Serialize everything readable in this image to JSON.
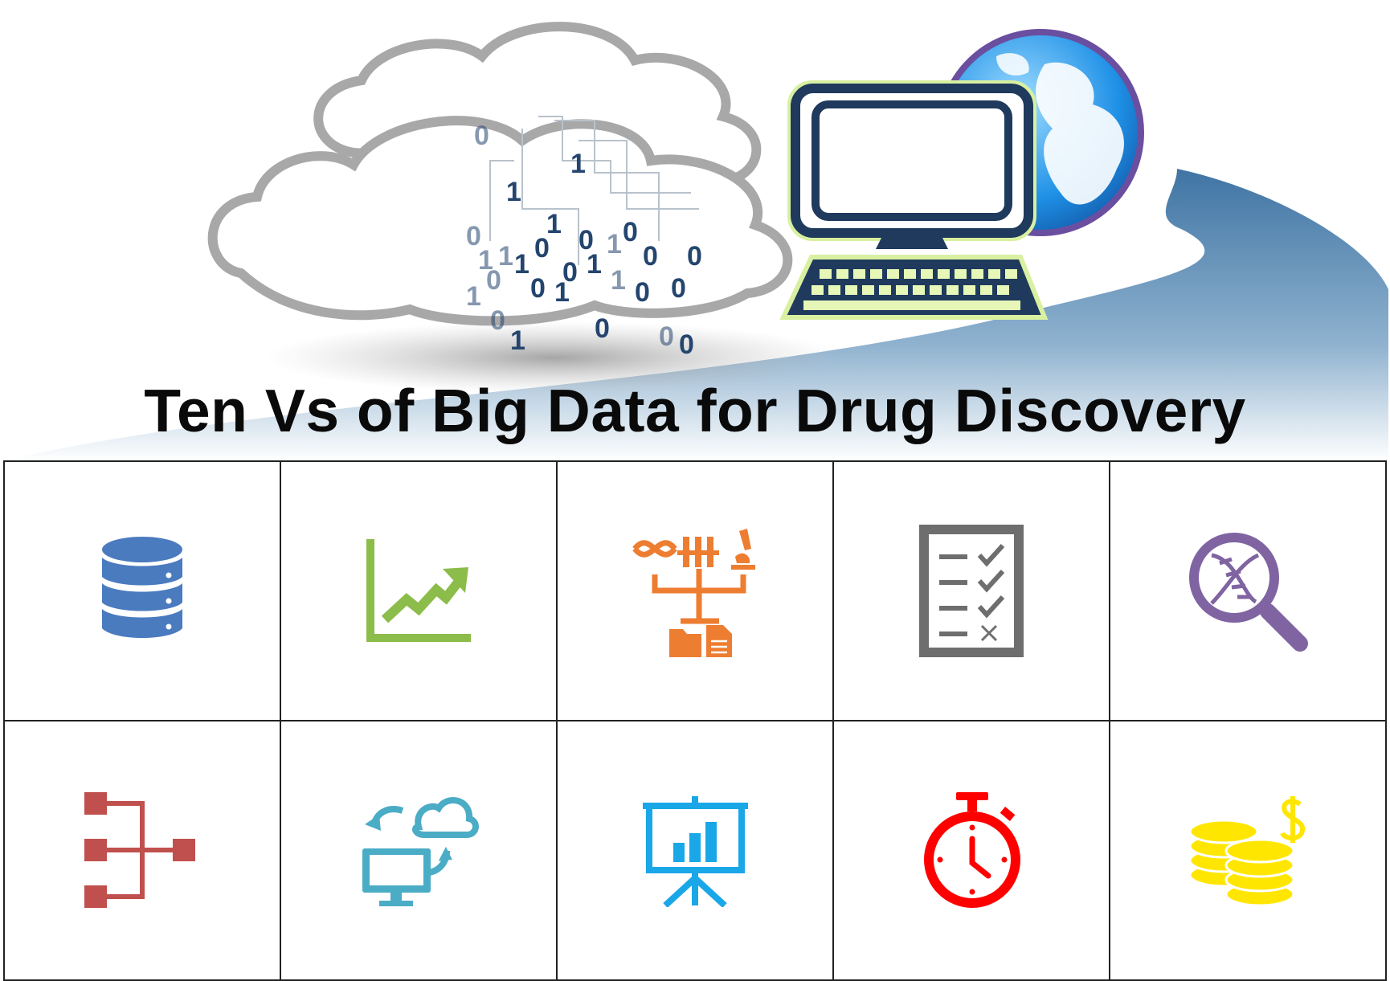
{
  "title": "Ten Vs of Big Data for Drug Discovery",
  "hero": {
    "binary_digits": [
      "0",
      "1",
      "1",
      "0",
      "1",
      "0",
      "1",
      "0",
      "0",
      "1",
      "0",
      "0",
      "1",
      "1",
      "1",
      "0",
      "0",
      "1",
      "1",
      "0",
      "0",
      "0",
      "0",
      "1",
      "0",
      "0",
      "0",
      "1"
    ],
    "icons": [
      "cloud-icon",
      "binary-data-icon",
      "computer-icon",
      "globe-icon"
    ]
  },
  "grid": {
    "rows": [
      [
        {
          "icon": "database-icon",
          "color": "#4a7bbf"
        },
        {
          "icon": "growth-chart-icon",
          "color": "#8cbc4a"
        },
        {
          "icon": "data-sources-tree-icon",
          "color": "#ed7d31"
        },
        {
          "icon": "checklist-icon",
          "color": "#6e6e6e"
        },
        {
          "icon": "dna-magnifier-icon",
          "color": "#8064a2"
        }
      ],
      [
        {
          "icon": "hierarchy-icon",
          "color": "#c0504d"
        },
        {
          "icon": "cloud-sync-icon",
          "color": "#4bacc6"
        },
        {
          "icon": "presentation-board-icon",
          "color": "#1aa7e8"
        },
        {
          "icon": "stopwatch-icon",
          "color": "#ff0000"
        },
        {
          "icon": "coins-dollar-icon",
          "color": "#ffe600"
        }
      ]
    ]
  }
}
